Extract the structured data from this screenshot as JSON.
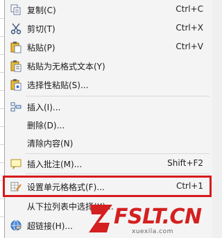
{
  "menu": {
    "items": [
      {
        "label": "复制(C)",
        "shortcut": "Ctrl+C",
        "icon": "copy-icon"
      },
      {
        "label": "剪切(T)",
        "shortcut": "Ctrl+X",
        "icon": "scissors-icon"
      },
      {
        "label": "粘贴(P)",
        "shortcut": "Ctrl+V",
        "icon": "paste-icon"
      },
      {
        "label": "粘贴为无格式文本(Y)",
        "shortcut": "",
        "icon": "paste-plain-icon"
      },
      {
        "label": "选择性粘贴(S)...",
        "shortcut": "",
        "icon": "paste-special-icon"
      },
      {
        "label": "插入(I)...",
        "shortcut": "",
        "icon": "insert-icon"
      },
      {
        "label": "删除(D)...",
        "shortcut": "",
        "icon": ""
      },
      {
        "label": "清除内容(N)",
        "shortcut": "",
        "icon": ""
      },
      {
        "label": "插入批注(M)...",
        "shortcut": "Shift+F2",
        "icon": "comment-icon"
      },
      {
        "label": "设置单元格格式(F)...",
        "shortcut": "Ctrl+1",
        "icon": "format-cells-icon"
      },
      {
        "label": "从下拉列表中选择(K)...",
        "shortcut": "",
        "icon": ""
      },
      {
        "label": "超链接(H)...",
        "shortcut": "",
        "icon": "hyperlink-icon"
      }
    ]
  },
  "watermark": {
    "brand": "FSLT.CN",
    "site": "xuexila.com"
  },
  "colors": {
    "highlight": "#d7191c",
    "menu_bg": "#f4f4f4"
  }
}
